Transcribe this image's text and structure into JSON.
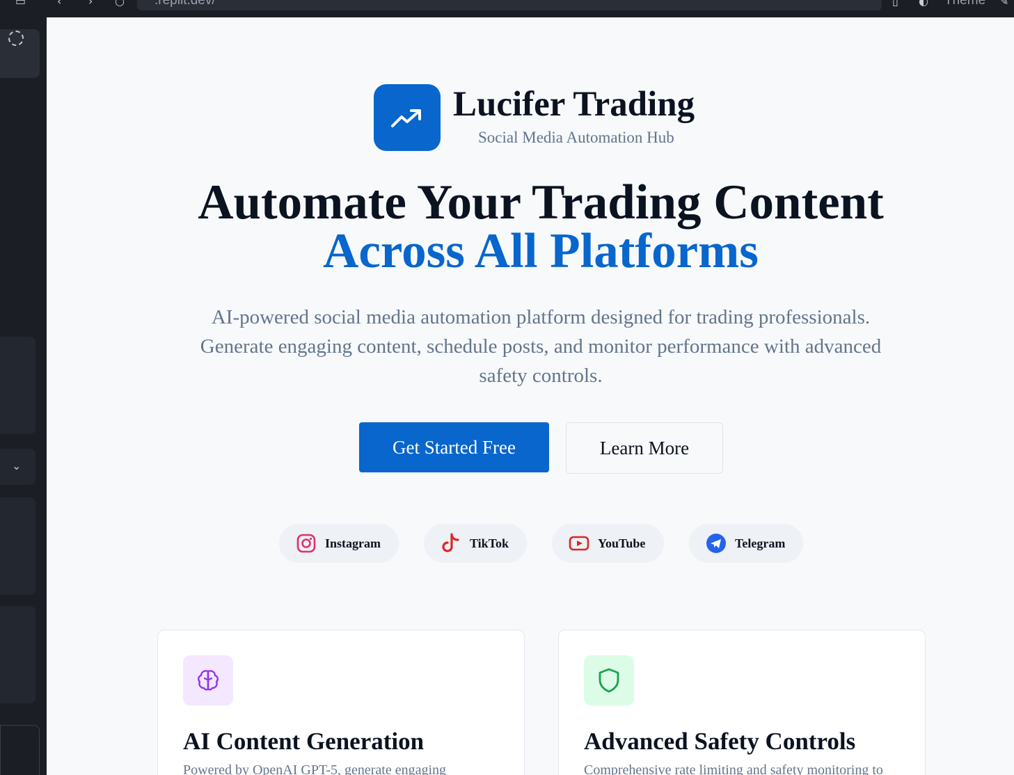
{
  "browser": {
    "url": ".replit.dev/",
    "theme_label": "Theme"
  },
  "brand": {
    "name": "Lucifer Trading",
    "tagline": "Social Media Automation Hub"
  },
  "hero": {
    "line1": "Automate Your Trading Content",
    "line2": "Across All Platforms",
    "description": "AI-powered social media automation platform designed for trading professionals. Generate engaging content, schedule posts, and monitor performance with advanced safety controls."
  },
  "actions": {
    "primary_label": "Get Started Free",
    "secondary_label": "Learn More"
  },
  "platforms": [
    {
      "label": "Instagram",
      "icon": "instagram-icon",
      "color": "#e1306c"
    },
    {
      "label": "TikTok",
      "icon": "tiktok-icon",
      "color": "#dc2626"
    },
    {
      "label": "YouTube",
      "icon": "youtube-icon",
      "color": "#dc2626"
    },
    {
      "label": "Telegram",
      "icon": "telegram-icon",
      "color": "#2563eb"
    }
  ],
  "features": [
    {
      "title": "AI Content Generation",
      "description": "Powered by OpenAI GPT-5, generate engaging",
      "icon": "brain-icon",
      "color": "#9333ea",
      "bg": "#f3e8ff"
    },
    {
      "title": "Advanced Safety Controls",
      "description": "Comprehensive rate limiting and safety monitoring to",
      "icon": "shield-icon",
      "color": "#16a34a",
      "bg": "#dcfce7"
    }
  ],
  "colors": {
    "accent": "#0866cc",
    "heading": "#0b1220",
    "muted": "#64748b",
    "page_bg": "#f7f9fb"
  }
}
